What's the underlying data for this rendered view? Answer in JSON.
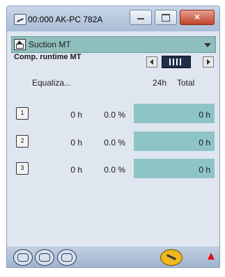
{
  "window": {
    "title": "00:000 AK-PC 782A"
  },
  "selector": {
    "value": "Suction MT"
  },
  "section": {
    "title": "Comp. runtime MT"
  },
  "columns": {
    "equalize": "Equaliza...",
    "h24": "24h",
    "total": "Total"
  },
  "rows": [
    {
      "id": "1",
      "hours": "0 h",
      "pct": "0.0 %",
      "total": "0 h"
    },
    {
      "id": "2",
      "hours": "0 h",
      "pct": "0.0 %",
      "total": "0 h"
    },
    {
      "id": "3",
      "hours": "0 h",
      "pct": "0.0 %",
      "total": "0 h"
    }
  ],
  "colors": {
    "teal": "#8fc4c6",
    "selector": "#8fbfbd",
    "alarm": "#e01010",
    "tool": "#f0b81c"
  },
  "icons": [
    "app-icon",
    "home-icon",
    "compressor-icon",
    "wrench-icon",
    "alarm-bell-icon"
  ]
}
